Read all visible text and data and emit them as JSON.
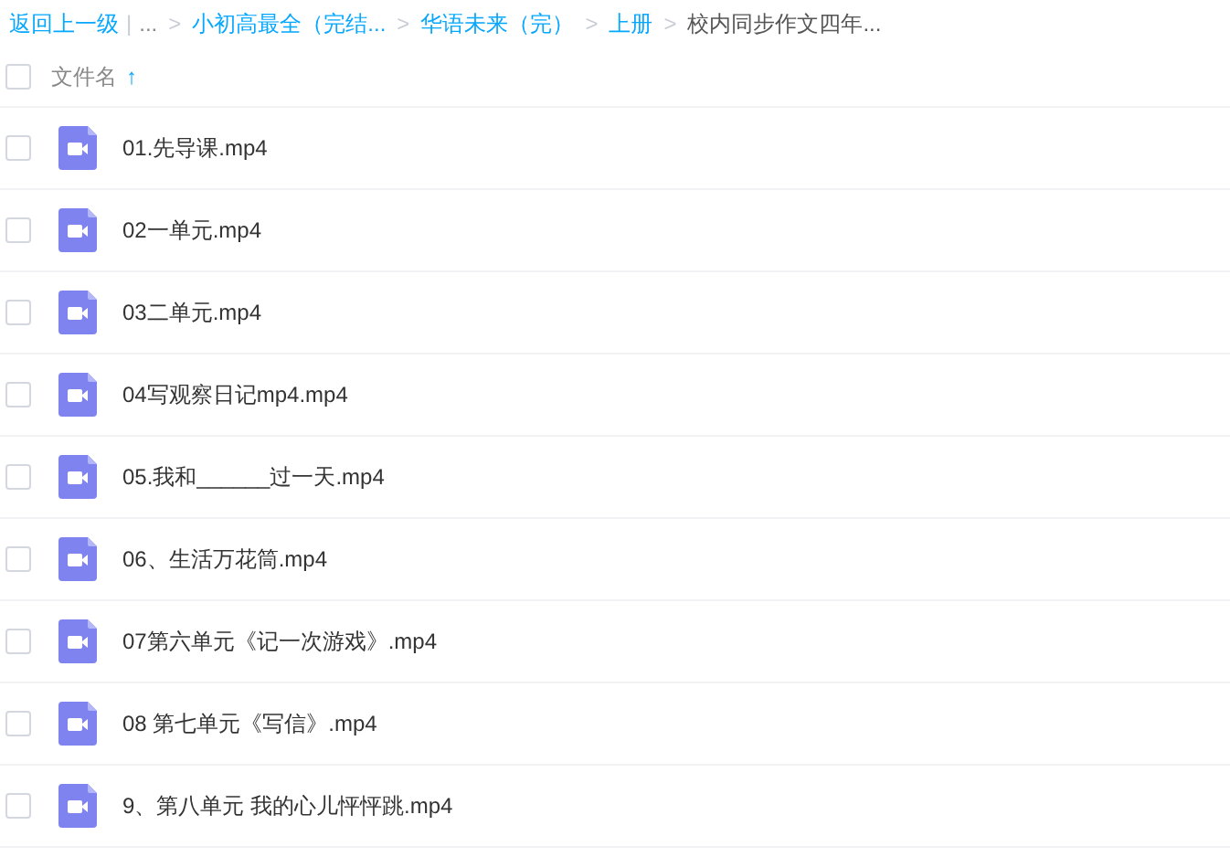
{
  "breadcrumb": [
    {
      "kind": "link",
      "text": "返回上一级"
    },
    {
      "kind": "divider",
      "text": "|"
    },
    {
      "kind": "plain",
      "text": "..."
    },
    {
      "kind": "sep",
      "text": ">"
    },
    {
      "kind": "link",
      "text": "小初高最全（完结..."
    },
    {
      "kind": "sep",
      "text": ">"
    },
    {
      "kind": "link",
      "text": "华语未来（完）"
    },
    {
      "kind": "sep",
      "text": ">"
    },
    {
      "kind": "link",
      "text": "上册"
    },
    {
      "kind": "sep",
      "text": ">"
    },
    {
      "kind": "current",
      "text": "校内同步作文四年..."
    }
  ],
  "header": {
    "checked": false,
    "label": "文件名",
    "sort_arrow": "↑"
  },
  "files": [
    {
      "name": "01.先导课.mp4",
      "checked": false
    },
    {
      "name": "02一单元.mp4",
      "checked": false
    },
    {
      "name": "03二单元.mp4",
      "checked": false
    },
    {
      "name": "04写观察日记mp4.mp4",
      "checked": false
    },
    {
      "name": "05.我和______过一天.mp4",
      "checked": false
    },
    {
      "name": "06、生活万花筒.mp4",
      "checked": false
    },
    {
      "name": "07第六单元《记一次游戏》.mp4",
      "checked": false
    },
    {
      "name": "08 第七单元《写信》.mp4",
      "checked": false
    },
    {
      "name": "9、第八单元 我的心儿怦怦跳.mp4",
      "checked": false
    }
  ]
}
